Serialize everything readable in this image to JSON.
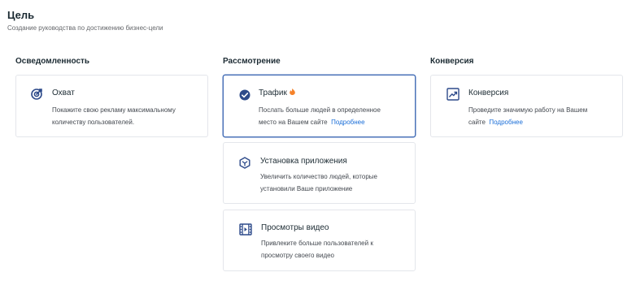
{
  "header": {
    "title": "Цель",
    "subtitle": "Создание руководства по достижению бизнес-цели"
  },
  "columns": {
    "awareness": {
      "title": "Осведомленность",
      "cards": {
        "reach": {
          "title": "Охват",
          "desc_line1": "Покажите свою рекламу максимальному",
          "desc_line2": "количеству пользователей.",
          "icon": "target-icon"
        }
      }
    },
    "consideration": {
      "title": "Рассмотрение",
      "cards": {
        "traffic": {
          "title": "Трафик",
          "desc_line1": "Послать больше людей в определенное",
          "desc_line2": "место на Вашем сайте",
          "more_link": "Подробнее",
          "icon": "check-circle-icon",
          "badge_icon": "fire-icon"
        },
        "app_install": {
          "title": "Установка приложения",
          "desc_line1": "Увеличить количество людей, которые",
          "desc_line2": "установили Ваше приложение",
          "icon": "app-cube-icon"
        },
        "video_views": {
          "title": "Просмотры видео",
          "desc_line1": "Привлеките больше пользователей к",
          "desc_line2": "просмотру своего видео",
          "icon": "film-icon"
        }
      }
    },
    "conversion": {
      "title": "Конверсия",
      "cards": {
        "conversions": {
          "title": "Конверсия",
          "desc_line1": "Проведите значимую работу на Вашем",
          "desc_line2": "сайте",
          "more_link": "Подробнее",
          "icon": "trend-chart-icon"
        }
      }
    }
  },
  "colors": {
    "accent": "#1a6ed8",
    "selected_border": "#4a72b8",
    "icon_blue": "#2d4a8a",
    "fire": "#f5822a"
  }
}
